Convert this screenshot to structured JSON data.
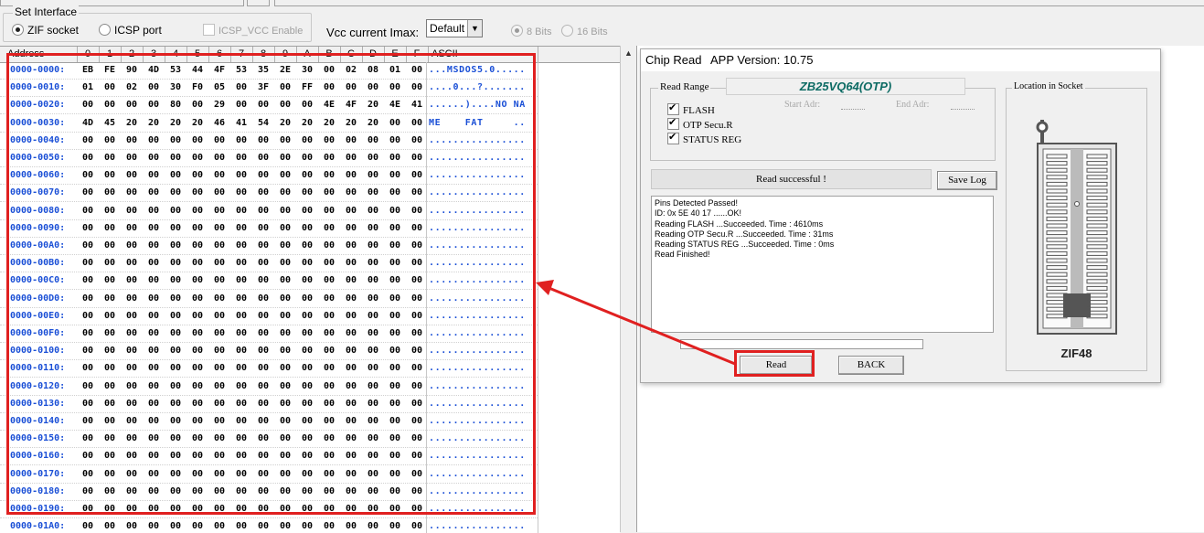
{
  "set_interface": {
    "title": "Set Interface",
    "zif_socket": "ZIF socket",
    "icsp_port": "ICSP port",
    "icsp_vcc": "ICSP_VCC Enable",
    "selected": "ZIF socket"
  },
  "vcc": {
    "label": "Vcc current Imax:",
    "value": "Default"
  },
  "bits": {
    "opt8": "8 Bits",
    "opt16": "16 Bits",
    "selected": "8 Bits"
  },
  "hex": {
    "columns": [
      "Address",
      "0",
      "1",
      "2",
      "3",
      "4",
      "5",
      "6",
      "7",
      "8",
      "9",
      "A",
      "B",
      "C",
      "D",
      "E",
      "F",
      "ASCII"
    ],
    "rows": [
      {
        "addr": "0000-0000:",
        "bytes": [
          "EB",
          "FE",
          "90",
          "4D",
          "53",
          "44",
          "4F",
          "53",
          "35",
          "2E",
          "30",
          "00",
          "02",
          "08",
          "01",
          "00"
        ],
        "ascii": "...MSDOS5.0....."
      },
      {
        "addr": "0000-0010:",
        "bytes": [
          "01",
          "00",
          "02",
          "00",
          "30",
          "F0",
          "05",
          "00",
          "3F",
          "00",
          "FF",
          "00",
          "00",
          "00",
          "00",
          "00"
        ],
        "ascii": "....0...?......."
      },
      {
        "addr": "0000-0020:",
        "bytes": [
          "00",
          "00",
          "00",
          "00",
          "80",
          "00",
          "29",
          "00",
          "00",
          "00",
          "00",
          "4E",
          "4F",
          "20",
          "4E",
          "41"
        ],
        "ascii": "......)....NO NA"
      },
      {
        "addr": "0000-0030:",
        "bytes": [
          "4D",
          "45",
          "20",
          "20",
          "20",
          "20",
          "46",
          "41",
          "54",
          "20",
          "20",
          "20",
          "20",
          "20",
          "00",
          "00"
        ],
        "ascii": "ME    FAT     .."
      },
      {
        "addr": "0000-0040:",
        "bytes": [
          "00",
          "00",
          "00",
          "00",
          "00",
          "00",
          "00",
          "00",
          "00",
          "00",
          "00",
          "00",
          "00",
          "00",
          "00",
          "00"
        ],
        "ascii": "................"
      },
      {
        "addr": "0000-0050:",
        "bytes": [
          "00",
          "00",
          "00",
          "00",
          "00",
          "00",
          "00",
          "00",
          "00",
          "00",
          "00",
          "00",
          "00",
          "00",
          "00",
          "00"
        ],
        "ascii": "................"
      },
      {
        "addr": "0000-0060:",
        "bytes": [
          "00",
          "00",
          "00",
          "00",
          "00",
          "00",
          "00",
          "00",
          "00",
          "00",
          "00",
          "00",
          "00",
          "00",
          "00",
          "00"
        ],
        "ascii": "................"
      },
      {
        "addr": "0000-0070:",
        "bytes": [
          "00",
          "00",
          "00",
          "00",
          "00",
          "00",
          "00",
          "00",
          "00",
          "00",
          "00",
          "00",
          "00",
          "00",
          "00",
          "00"
        ],
        "ascii": "................"
      },
      {
        "addr": "0000-0080:",
        "bytes": [
          "00",
          "00",
          "00",
          "00",
          "00",
          "00",
          "00",
          "00",
          "00",
          "00",
          "00",
          "00",
          "00",
          "00",
          "00",
          "00"
        ],
        "ascii": "................"
      },
      {
        "addr": "0000-0090:",
        "bytes": [
          "00",
          "00",
          "00",
          "00",
          "00",
          "00",
          "00",
          "00",
          "00",
          "00",
          "00",
          "00",
          "00",
          "00",
          "00",
          "00"
        ],
        "ascii": "................"
      },
      {
        "addr": "0000-00A0:",
        "bytes": [
          "00",
          "00",
          "00",
          "00",
          "00",
          "00",
          "00",
          "00",
          "00",
          "00",
          "00",
          "00",
          "00",
          "00",
          "00",
          "00"
        ],
        "ascii": "................"
      },
      {
        "addr": "0000-00B0:",
        "bytes": [
          "00",
          "00",
          "00",
          "00",
          "00",
          "00",
          "00",
          "00",
          "00",
          "00",
          "00",
          "00",
          "00",
          "00",
          "00",
          "00"
        ],
        "ascii": "................"
      },
      {
        "addr": "0000-00C0:",
        "bytes": [
          "00",
          "00",
          "00",
          "00",
          "00",
          "00",
          "00",
          "00",
          "00",
          "00",
          "00",
          "00",
          "00",
          "00",
          "00",
          "00"
        ],
        "ascii": "................"
      },
      {
        "addr": "0000-00D0:",
        "bytes": [
          "00",
          "00",
          "00",
          "00",
          "00",
          "00",
          "00",
          "00",
          "00",
          "00",
          "00",
          "00",
          "00",
          "00",
          "00",
          "00"
        ],
        "ascii": "................"
      },
      {
        "addr": "0000-00E0:",
        "bytes": [
          "00",
          "00",
          "00",
          "00",
          "00",
          "00",
          "00",
          "00",
          "00",
          "00",
          "00",
          "00",
          "00",
          "00",
          "00",
          "00"
        ],
        "ascii": "................"
      },
      {
        "addr": "0000-00F0:",
        "bytes": [
          "00",
          "00",
          "00",
          "00",
          "00",
          "00",
          "00",
          "00",
          "00",
          "00",
          "00",
          "00",
          "00",
          "00",
          "00",
          "00"
        ],
        "ascii": "................"
      },
      {
        "addr": "0000-0100:",
        "bytes": [
          "00",
          "00",
          "00",
          "00",
          "00",
          "00",
          "00",
          "00",
          "00",
          "00",
          "00",
          "00",
          "00",
          "00",
          "00",
          "00"
        ],
        "ascii": "................"
      },
      {
        "addr": "0000-0110:",
        "bytes": [
          "00",
          "00",
          "00",
          "00",
          "00",
          "00",
          "00",
          "00",
          "00",
          "00",
          "00",
          "00",
          "00",
          "00",
          "00",
          "00"
        ],
        "ascii": "................"
      },
      {
        "addr": "0000-0120:",
        "bytes": [
          "00",
          "00",
          "00",
          "00",
          "00",
          "00",
          "00",
          "00",
          "00",
          "00",
          "00",
          "00",
          "00",
          "00",
          "00",
          "00"
        ],
        "ascii": "................"
      },
      {
        "addr": "0000-0130:",
        "bytes": [
          "00",
          "00",
          "00",
          "00",
          "00",
          "00",
          "00",
          "00",
          "00",
          "00",
          "00",
          "00",
          "00",
          "00",
          "00",
          "00"
        ],
        "ascii": "................"
      },
      {
        "addr": "0000-0140:",
        "bytes": [
          "00",
          "00",
          "00",
          "00",
          "00",
          "00",
          "00",
          "00",
          "00",
          "00",
          "00",
          "00",
          "00",
          "00",
          "00",
          "00"
        ],
        "ascii": "................"
      },
      {
        "addr": "0000-0150:",
        "bytes": [
          "00",
          "00",
          "00",
          "00",
          "00",
          "00",
          "00",
          "00",
          "00",
          "00",
          "00",
          "00",
          "00",
          "00",
          "00",
          "00"
        ],
        "ascii": "................"
      },
      {
        "addr": "0000-0160:",
        "bytes": [
          "00",
          "00",
          "00",
          "00",
          "00",
          "00",
          "00",
          "00",
          "00",
          "00",
          "00",
          "00",
          "00",
          "00",
          "00",
          "00"
        ],
        "ascii": "................"
      },
      {
        "addr": "0000-0170:",
        "bytes": [
          "00",
          "00",
          "00",
          "00",
          "00",
          "00",
          "00",
          "00",
          "00",
          "00",
          "00",
          "00",
          "00",
          "00",
          "00",
          "00"
        ],
        "ascii": "................"
      },
      {
        "addr": "0000-0180:",
        "bytes": [
          "00",
          "00",
          "00",
          "00",
          "00",
          "00",
          "00",
          "00",
          "00",
          "00",
          "00",
          "00",
          "00",
          "00",
          "00",
          "00"
        ],
        "ascii": "................"
      },
      {
        "addr": "0000-0190:",
        "bytes": [
          "00",
          "00",
          "00",
          "00",
          "00",
          "00",
          "00",
          "00",
          "00",
          "00",
          "00",
          "00",
          "00",
          "00",
          "00",
          "00"
        ],
        "ascii": "................"
      },
      {
        "addr": "0000-01A0:",
        "bytes": [
          "00",
          "00",
          "00",
          "00",
          "00",
          "00",
          "00",
          "00",
          "00",
          "00",
          "00",
          "00",
          "00",
          "00",
          "00",
          "00"
        ],
        "ascii": "................"
      }
    ]
  },
  "dialog": {
    "title": "Chip Read",
    "version": "APP Version: 10.75",
    "chip_name": "ZB25VQ64(OTP)",
    "read_range_title": "Read Range",
    "range_items": [
      "FLASH",
      "OTP Secu.R",
      "STATUS REG"
    ],
    "start_adr": "Start Adr:",
    "end_adr": "End Adr:",
    "status": "Read successful !",
    "save_log": "Save Log",
    "log_lines": [
      "Pins Detected Passed!",
      "ID: 0x 5E 40 17 ......OK!",
      "Reading FLASH ...Succeeded. Time : 4610ms",
      "Reading OTP Secu.R ...Succeeded. Time : 31ms",
      "Reading STATUS REG ...Succeeded. Time : 0ms",
      "Read Finished!"
    ],
    "read_button": "Read",
    "back_button": "BACK",
    "socket_title": "Location in Socket",
    "zif_label": "ZIF48"
  },
  "colors": {
    "highlight": "#e02020",
    "address": "#1a4fd6",
    "chip_name": "#0d6b64"
  }
}
